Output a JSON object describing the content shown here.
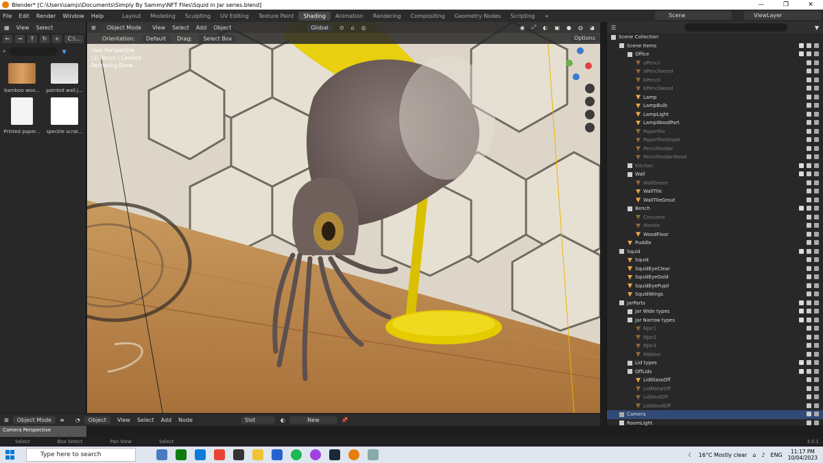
{
  "window": {
    "title": "Blender* [C:\\Users\\samjs\\Documents\\Simply By Sammy\\NFT Files\\Squid in Jar series.blend]",
    "controls": [
      "—",
      "❐",
      "✕"
    ]
  },
  "menu": [
    "File",
    "Edit",
    "Render",
    "Window",
    "Help"
  ],
  "workspaces": [
    "Layout",
    "Modeling",
    "Sculpting",
    "UV Editing",
    "Texture Paint",
    "Shading",
    "Animation",
    "Rendering",
    "Compositing",
    "Geometry Nodes",
    "Scripting",
    "+"
  ],
  "active_workspace": "Shading",
  "scene": "Scene",
  "view_layer": "ViewLayer",
  "file_browser": {
    "menu": [
      "View",
      "Select"
    ],
    "path_label": "C:\\...",
    "items": [
      {
        "label": "bamboo woo...",
        "kind": "bamboo"
      },
      {
        "label": "painted wall.j...",
        "kind": "wall"
      },
      {
        "label": "Printed paper...",
        "kind": "paper"
      },
      {
        "label": "speckle scrat...",
        "kind": "speckle"
      }
    ]
  },
  "viewport": {
    "mode": "Object Mode",
    "menu": [
      "View",
      "Select",
      "Add",
      "Object"
    ],
    "transform": "Global",
    "orientation_label": "Orientation:",
    "orientation_value": "Default",
    "drag_label": "Drag:",
    "drag_value": "Select Box",
    "options": "Options",
    "info_lines": [
      "User Perspective",
      "(1) Bench | Camera",
      "Rendering Done"
    ]
  },
  "outliner": {
    "rows": [
      {
        "label": "Scene Collection",
        "indent": 0,
        "type": "scene",
        "dim": false
      },
      {
        "label": "Scene Items",
        "indent": 1,
        "type": "coll",
        "dim": false
      },
      {
        "label": "Office",
        "indent": 2,
        "type": "coll",
        "dim": false
      },
      {
        "label": "aPencil",
        "indent": 3,
        "type": "obj",
        "dim": true
      },
      {
        "label": "aPencilwood",
        "indent": 3,
        "type": "obj",
        "dim": true
      },
      {
        "label": "bPencil",
        "indent": 3,
        "type": "obj",
        "dim": true
      },
      {
        "label": "bPencilwood",
        "indent": 3,
        "type": "obj",
        "dim": true
      },
      {
        "label": "Lamp",
        "indent": 3,
        "type": "obj",
        "dim": false
      },
      {
        "label": "LampBulb",
        "indent": 3,
        "type": "obj",
        "dim": false
      },
      {
        "label": "LampLight",
        "indent": 3,
        "type": "obj",
        "dim": false
      },
      {
        "label": "LampWoodPart",
        "indent": 3,
        "type": "obj",
        "dim": false
      },
      {
        "label": "PaperPile",
        "indent": 3,
        "type": "obj",
        "dim": true
      },
      {
        "label": "PaperPileStaple",
        "indent": 3,
        "type": "obj",
        "dim": true
      },
      {
        "label": "PencilHolder",
        "indent": 3,
        "type": "obj",
        "dim": true
      },
      {
        "label": "PencilHolderWood",
        "indent": 3,
        "type": "obj",
        "dim": true
      },
      {
        "label": "Kitchen",
        "indent": 2,
        "type": "coll",
        "dim": true
      },
      {
        "label": "Wall",
        "indent": 2,
        "type": "coll",
        "dim": false
      },
      {
        "label": "WallGreen",
        "indent": 3,
        "type": "obj",
        "dim": true
      },
      {
        "label": "WallTile",
        "indent": 3,
        "type": "obj",
        "dim": false
      },
      {
        "label": "WallTileGrout",
        "indent": 3,
        "type": "obj",
        "dim": false
      },
      {
        "label": "Bench",
        "indent": 2,
        "type": "coll",
        "dim": false
      },
      {
        "label": "Concrete",
        "indent": 3,
        "type": "obj",
        "dim": true
      },
      {
        "label": "Marble",
        "indent": 3,
        "type": "obj",
        "dim": true
      },
      {
        "label": "WoodFloor",
        "indent": 3,
        "type": "obj",
        "dim": false
      },
      {
        "label": "Puddle",
        "indent": 2,
        "type": "obj",
        "dim": false
      },
      {
        "label": "Squid",
        "indent": 1,
        "type": "coll",
        "dim": false
      },
      {
        "label": "Squid",
        "indent": 2,
        "type": "obj",
        "dim": false
      },
      {
        "label": "SquidEyeClear",
        "indent": 2,
        "type": "obj",
        "dim": false
      },
      {
        "label": "SquidEyeGold",
        "indent": 2,
        "type": "obj",
        "dim": false
      },
      {
        "label": "SquidEyePupil",
        "indent": 2,
        "type": "obj",
        "dim": false
      },
      {
        "label": "SquidWings",
        "indent": 2,
        "type": "obj",
        "dim": false
      },
      {
        "label": "JarParts",
        "indent": 1,
        "type": "coll",
        "dim": false
      },
      {
        "label": "Jar Wide types",
        "indent": 2,
        "type": "coll",
        "dim": false
      },
      {
        "label": "Jar Narrow types",
        "indent": 2,
        "type": "coll",
        "dim": false
      },
      {
        "label": "NJar1",
        "indent": 3,
        "type": "obj",
        "dim": true
      },
      {
        "label": "NJar2",
        "indent": 3,
        "type": "obj",
        "dim": true
      },
      {
        "label": "NJar3",
        "indent": 3,
        "type": "obj",
        "dim": true
      },
      {
        "label": "NWater",
        "indent": 3,
        "type": "obj",
        "dim": true
      },
      {
        "label": "Lid types",
        "indent": 2,
        "type": "coll",
        "dim": false
      },
      {
        "label": "OffLids",
        "indent": 2,
        "type": "coll",
        "dim": false
      },
      {
        "label": "LidGlassOff",
        "indent": 3,
        "type": "obj",
        "dim": false
      },
      {
        "label": "LidMetalOff",
        "indent": 3,
        "type": "obj",
        "dim": true
      },
      {
        "label": "LidSealOff",
        "indent": 3,
        "type": "obj",
        "dim": true
      },
      {
        "label": "LidWoodOff",
        "indent": 3,
        "type": "obj",
        "dim": true
      },
      {
        "label": "Camera",
        "indent": 1,
        "type": "cam",
        "dim": false,
        "selected": true
      },
      {
        "label": "RoomLight",
        "indent": 1,
        "type": "light",
        "dim": false
      }
    ]
  },
  "bottom": {
    "mode": "Object Mode",
    "node_editor_type": "Object",
    "node_menu": [
      "View",
      "Select",
      "Add",
      "Node"
    ],
    "slot": "Slot",
    "new_button": "New",
    "camera_thumb": "Camera Perspective"
  },
  "status": [
    "Select",
    "Box Select",
    "Pan View",
    "Select"
  ],
  "version": "3.0.1",
  "taskbar": {
    "search_placeholder": "Type here to search",
    "weather": "16°C  Mostly clear",
    "lang": "ENG",
    "time": "11:17 PM",
    "date": "10/04/2023"
  }
}
